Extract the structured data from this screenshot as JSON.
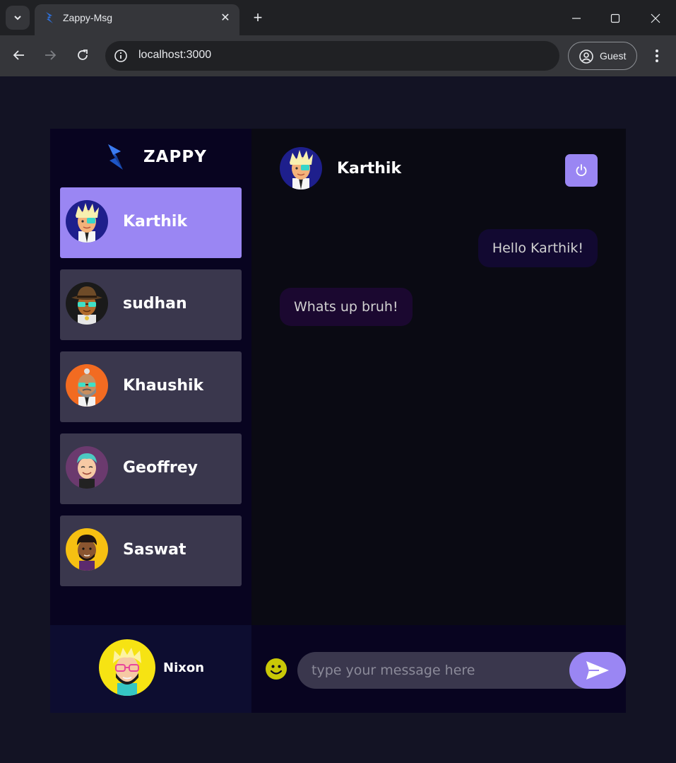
{
  "browser": {
    "tab_title": "Zappy-Msg",
    "tab_close": "✕",
    "new_tab": "+",
    "url": "localhost:3000",
    "profile_label": "Guest"
  },
  "app": {
    "brand": "ZAPPY",
    "colors": {
      "accent": "#9a86f3",
      "sidebar_bg": "#080420",
      "chat_bg": "#0a0a13",
      "page_bg": "#131324"
    },
    "contacts": [
      {
        "name": "Karthik",
        "selected": true,
        "avatar_icon": "avatar-blonde-spiky-icon"
      },
      {
        "name": "sudhan",
        "selected": false,
        "avatar_icon": "avatar-hat-sunglasses-icon"
      },
      {
        "name": "Khaushik",
        "selected": false,
        "avatar_icon": "avatar-bald-beard-icon"
      },
      {
        "name": "Geoffrey",
        "selected": false,
        "avatar_icon": "avatar-teal-hair-icon"
      },
      {
        "name": "Saswat",
        "selected": false,
        "avatar_icon": "avatar-curly-beard-icon"
      }
    ],
    "current_user": {
      "name": "Nixon",
      "avatar_icon": "avatar-yellow-hair-glasses-icon"
    },
    "chat": {
      "contact_name": "Karthik",
      "messages": [
        {
          "direction": "sent",
          "text": "Hello Karthik!"
        },
        {
          "direction": "received",
          "text": "Whats up bruh!"
        }
      ],
      "input_placeholder": "type your message here"
    }
  }
}
